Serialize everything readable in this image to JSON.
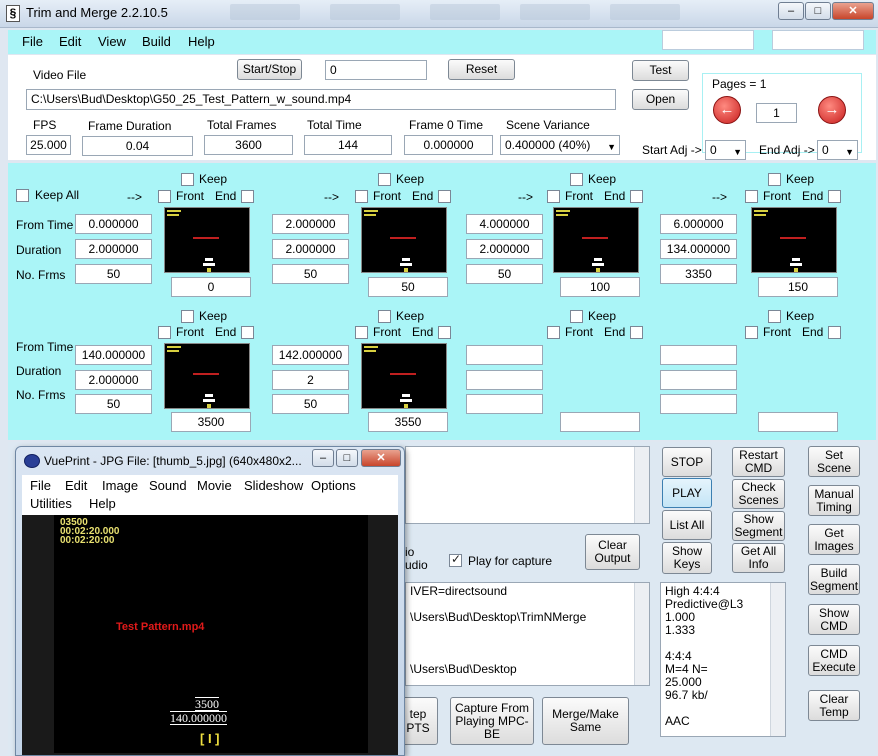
{
  "window": {
    "title": "Trim and Merge 2.2.10.5",
    "icon": "app-icon"
  },
  "menu": [
    "File",
    "Edit",
    "View",
    "Build",
    "Help"
  ],
  "top": {
    "video_file_label": "Video File",
    "video_file": "C:\\Users\\Bud\\Desktop\\G50_25_Test_Pattern_w_sound.mp4",
    "start_stop_label": "Start/Stop",
    "start_stop_value": "0",
    "reset_label": "Reset",
    "test_label": "Test",
    "open_label": "Open",
    "fps_label": "FPS",
    "fps": "25.000",
    "frame_duration_label": "Frame Duration",
    "frame_duration": "0.04",
    "total_frames_label": "Total Frames",
    "total_frames": "3600",
    "total_time_label": "Total Time",
    "total_time": "144",
    "frame0_label": "Frame 0 Time",
    "frame0": "0.000000",
    "scene_variance_label": "Scene Variance",
    "scene_variance": "0.400000  (40%)",
    "pages_label": "Pages = 1",
    "page": "1",
    "start_adj_label": "Start Adj ->",
    "start_adj": "0",
    "end_adj_label": "End Adj ->",
    "end_adj": "0"
  },
  "segments_ui": {
    "keep_all": "Keep All",
    "keep": "Keep",
    "front": "Front",
    "end": "End",
    "arrow": "-->",
    "from_time": "From Time",
    "duration": "Duration",
    "no_frms": "No. Frms"
  },
  "segments": [
    {
      "from": "0.000000",
      "duration": "2.000000",
      "frames": "50",
      "frame_no": "0"
    },
    {
      "from": "2.000000",
      "duration": "2.000000",
      "frames": "50",
      "frame_no": "50"
    },
    {
      "from": "4.000000",
      "duration": "2.000000",
      "frames": "50",
      "frame_no": "100"
    },
    {
      "from": "6.000000",
      "duration": "134.000000",
      "frames": "3350",
      "frame_no": "150"
    },
    {
      "from": "140.000000",
      "duration": "2.000000",
      "frames": "50",
      "frame_no": "3500"
    },
    {
      "from": "142.000000",
      "duration": "2",
      "frames": "50",
      "frame_no": "3550"
    },
    {
      "from": "",
      "duration": "",
      "frames": "",
      "frame_no": ""
    },
    {
      "from": "",
      "duration": "",
      "frames": "",
      "frame_no": ""
    }
  ],
  "bottom": {
    "stop": "STOP",
    "play": "PLAY",
    "list_all": "List All",
    "show_keys": "Show Keys",
    "restart_cmd": "Restart CMD",
    "check_scenes": "Check Scenes",
    "show_segment": "Show Segment",
    "get_all_info": "Get All Info",
    "set_scene": "Set Scene",
    "manual_timing": "Manual Timing",
    "get_images": "Get Images",
    "build_segment": "Build Segment",
    "show_cmd": "Show CMD",
    "cmd_execute": "CMD Execute",
    "clear_temp": "Clear Temp",
    "clear_output": "Clear Output",
    "play_for_capture": "Play for capture",
    "audio_partial": "io\nudio",
    "capture_from_playing": "Capture From Playing MPC-BE",
    "merge_make_same": "Merge/Make Same",
    "step_partial": "tep\nPTS",
    "cmd_text": "IVER=directsound\n\n\\Users\\Bud\\Desktop\\TrimNMerge\n\n\n\n\\Users\\Bud\\Desktop",
    "info_text": "High 4:4:4\nPredictive@L3\n1.000\n1.333\n\n4:4:4\nM=4 N=\n25.000\n96.7 kb/\n\nAAC"
  },
  "viewer": {
    "title": "VuePrint - JPG File: [thumb_5.jpg] (640x480x2...",
    "menu": [
      "File",
      "Edit",
      "Image",
      "Sound",
      "Movie",
      "Slideshow",
      "Options"
    ],
    "menu2": [
      "Utilities",
      "Help"
    ],
    "overlay_lines": [
      "03500",
      "00:02:20.000",
      "00:02:20:00"
    ],
    "caption": "Test Pattern.mp4",
    "frame_no": "3500",
    "time": "140.000000",
    "marker": "[ I ]"
  },
  "colors": {
    "accent_panel": "#aaf5f7",
    "nav_red": "#c81e1e"
  }
}
